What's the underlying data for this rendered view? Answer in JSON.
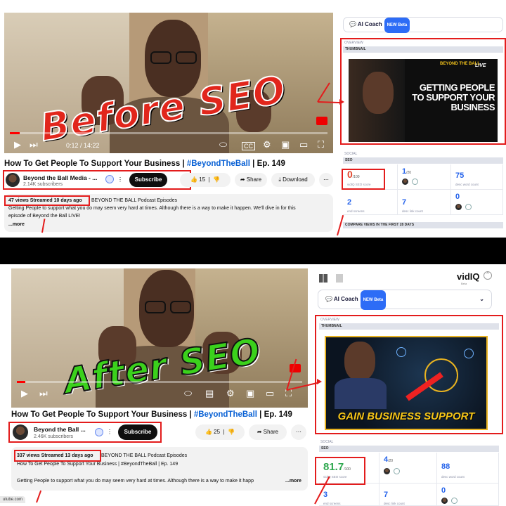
{
  "before": {
    "overlay": "Before SEO",
    "time": "0:12 / 14:22",
    "title_main": "How To Get People To Support Your Business | ",
    "title_hash": "#BeyondTheBall",
    "title_tail": " | Ep. 149",
    "channel": "Beyond the Ball Media - ...",
    "subs": "2.14K subscribers",
    "subscribe": "Subscribe",
    "likes": "15",
    "share": "Share",
    "download": "Download",
    "meta": "47 views  Streamed 10 days ago",
    "meta_tail": "BEYOND THE BALL Podcast Episodes",
    "desc1": "Getting People to support what you do may seem very hard at times. Although there is a way to make it happen. We'll dive in for this",
    "desc2": "episode of Beyond the Ball LIVE!",
    "more": "...more",
    "coach": "AI Coach",
    "new_badge": "NEW Beta",
    "overview": "OVERVIEW",
    "thumbnail": "THUMBNAIL",
    "thumb_brand": "BEYOND THE BALL",
    "thumb_live": "LIVE",
    "thumb_text": "GETTING PEOPLE TO SUPPORT YOUR BUSINESS",
    "social": "SOCIAL",
    "seo": "SEO",
    "seo_score": "0",
    "seo_score_sub": "/100",
    "seo_cap": "vidIQ SEO score",
    "tags_rank": "1",
    "tags_rank_sub": "/20",
    "desc_words": "75",
    "desc_words_cap": "desc word count",
    "end_screens": "2",
    "end_screens_cap": "end screens",
    "desc_links": "7",
    "desc_links_cap": "desc link count",
    "cards": "0",
    "compare": "COMPARE VIEWS IN THE FIRST 28 DAYS"
  },
  "after": {
    "overlay": "After SEO",
    "title_main": "How To Get People To Support Your Business | ",
    "title_hash": "#BeyondTheBall",
    "title_tail": " | Ep. 149",
    "channel": "Beyond the Ball ...",
    "subs": "2.46K subscribers",
    "subscribe": "Subscribe",
    "likes": "25",
    "share": "Share",
    "meta": "337 views  Streamed 13 days ago",
    "meta_tail": "BEYOND THE BALL Podcast Episodes",
    "desc_title": "How To Get People To Support Your Business | #BeyondTheBall | Ep. 149",
    "desc1": "Getting People to support what you do may seem very hard at times. Although there is a way to make it happ",
    "more": "...more",
    "brand": "vidIQ",
    "brand_sub": "Beta",
    "coach": "AI Coach",
    "new_badge": "NEW Beta",
    "overview": "OVERVIEW",
    "thumbnail": "THUMBNAIL",
    "thumb_text": "GAIN BUSINESS SUPPORT",
    "social": "SOCIAL",
    "seo": "SEO",
    "seo_score": "81.7",
    "seo_score_sub": "/100",
    "seo_cap": "vidIQ SEO score",
    "tags_rank": "4",
    "tags_rank_sub": "/20",
    "desc_words": "88",
    "desc_words_cap": "desc word count",
    "end_screens": "3",
    "end_screens_cap": "end screens",
    "desc_links": "7",
    "desc_links_cap": "desc link count",
    "cards": "0"
  },
  "footer_url": "utube.com",
  "colors": {
    "accent_red": "#e31c1c",
    "vidiq_blue": "#2563eb",
    "seo_bad": "#e0452b",
    "seo_good": "#2fa84f"
  }
}
